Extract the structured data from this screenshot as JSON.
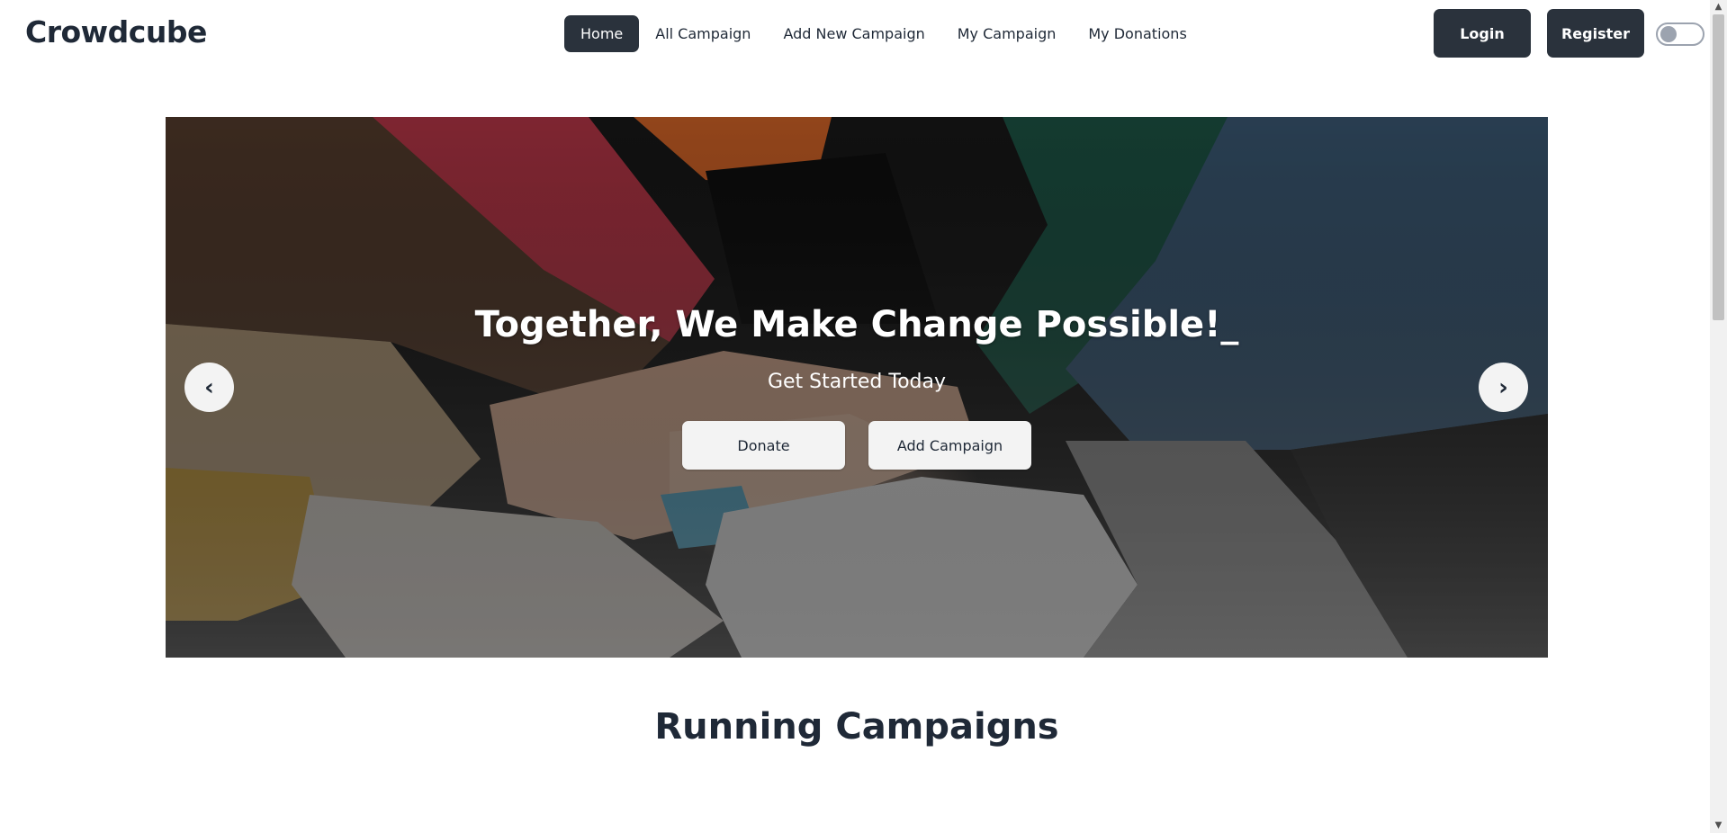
{
  "brand": "Crowdcube",
  "nav": {
    "items": [
      {
        "label": "Home",
        "active": true
      },
      {
        "label": "All Campaign",
        "active": false
      },
      {
        "label": "Add New Campaign",
        "active": false
      },
      {
        "label": "My Campaign",
        "active": false
      },
      {
        "label": "My Donations",
        "active": false
      }
    ]
  },
  "auth": {
    "login_label": "Login",
    "register_label": "Register"
  },
  "theme_toggle": {
    "icon": "theme-toggle",
    "on": false
  },
  "hero": {
    "title": "Together, We Make Change Possible!_",
    "subtitle": "Get Started Today",
    "donate_label": "Donate",
    "add_campaign_label": "Add Campaign",
    "prev_icon": "‹",
    "next_icon": "›",
    "image_icon": "hands-together-photo"
  },
  "sections": {
    "running_title": "Running Campaigns"
  },
  "colors": {
    "primary_dark": "#2a323c",
    "text_dark": "#1f2937",
    "light_button": "#f3f3f3"
  }
}
